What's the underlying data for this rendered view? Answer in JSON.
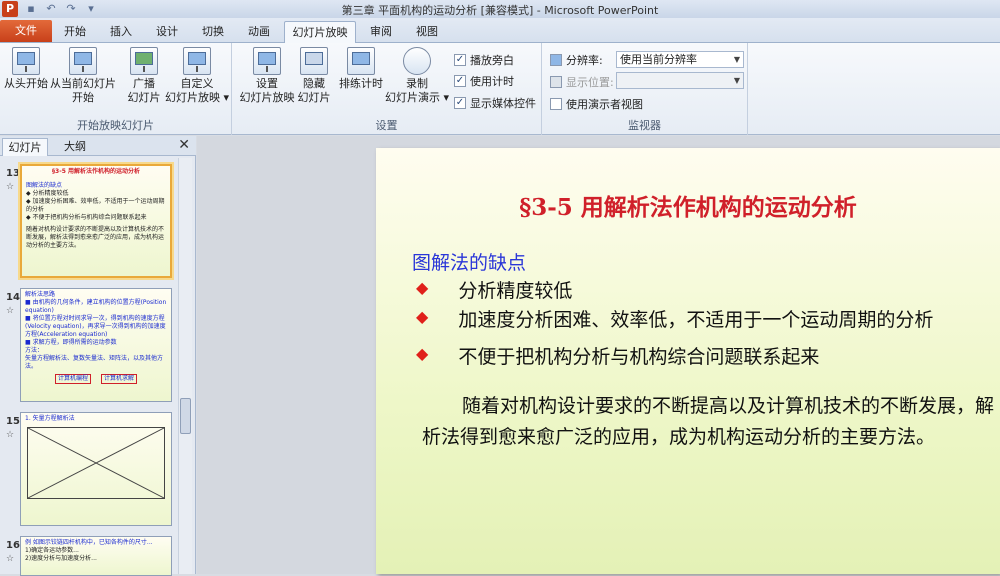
{
  "window": {
    "title": "第三章 平面机构的运动分析 [兼容模式] - Microsoft PowerPoint",
    "app_letter": "P"
  },
  "tabs": [
    "文件",
    "开始",
    "插入",
    "设计",
    "切换",
    "动画",
    "幻灯片放映",
    "审阅",
    "视图"
  ],
  "active_tab": "幻灯片放映",
  "ribbon": {
    "group_start": {
      "label": "开始放映幻灯片",
      "buttons": [
        {
          "line1": "从头开始",
          "line2": ""
        },
        {
          "line1": "从当前幻灯片",
          "line2": "开始"
        },
        {
          "line1": "广播",
          "line2": "幻灯片"
        },
        {
          "line1": "自定义",
          "line2": "幻灯片放映 ▾"
        }
      ]
    },
    "group_setup": {
      "label": "设置",
      "buttons": [
        {
          "line1": "设置",
          "line2": "幻灯片放映"
        },
        {
          "line1": "隐藏",
          "line2": "幻灯片"
        },
        {
          "line1": "排练计时",
          "line2": ""
        },
        {
          "line1": "录制",
          "line2": "幻灯片演示 ▾"
        }
      ],
      "checks": [
        {
          "label": "播放旁白",
          "checked": true
        },
        {
          "label": "使用计时",
          "checked": true
        },
        {
          "label": "显示媒体控件",
          "checked": true
        }
      ]
    },
    "group_monitor": {
      "label": "监视器",
      "resolution_label": "分辨率:",
      "resolution_value": "使用当前分辨率",
      "display_label": "显示位置:",
      "display_value": "",
      "presenter_view": "使用演示者视图"
    }
  },
  "panel": {
    "tab_slides": "幻灯片",
    "tab_outline": "大纲",
    "close": "✕",
    "slides": [
      {
        "num": "13",
        "star": "☆"
      },
      {
        "num": "14",
        "star": "☆"
      },
      {
        "num": "15",
        "star": "☆"
      },
      {
        "num": "16",
        "star": "☆"
      }
    ],
    "thumb13": {
      "title": "§3-5 用解析法作机构的运动分析",
      "lines": [
        "图解法的缺点",
        "◆ 分析精度较低",
        "◆ 加速度分析困难、效率低，不适用于一个运动周期的分析",
        "◆ 不便于把机构分析与机构综合问题联系起来",
        "随着对机构设计要求的不断提高以及计算机技术的不断发展，解析法得到愈来愈广泛的应用，成为机构运动分析的主要方法。"
      ]
    },
    "thumb14": {
      "lines": [
        "解析法思路",
        "■ 由机构的几何条件，建立机构的位置方程(Position equation)",
        "■ 将位置方程对时间求导一次，得到机构的速度方程(Velocity equation)，再求导一次得到机构的加速度方程(Acceleration equation)",
        "■ 求解方程，即得所需的运动参数",
        "方法：",
        "矢量方程解析法、复数矢量法、矩阵法，以及其他方法。"
      ],
      "boxes": [
        "计算机编程",
        "计算机求解"
      ]
    },
    "thumb15": {
      "lines": [
        "1. 矢量方程解析法"
      ]
    },
    "thumb16": {
      "lines": [
        "例 如图示铰链四杆机构中，已知各构件的尺寸...",
        "1)确定各运动参数...",
        "2)速度分析与加速度分析..."
      ]
    }
  },
  "slide": {
    "title": "§3-5  用解析法作机构的运动分析",
    "subtitle": "图解法的缺点",
    "bullets": [
      "分析精度较低",
      "加速度分析困难、效率低，不适用于一个运动周期的分析",
      "不便于把机构分析与机构综合问题联系起来"
    ],
    "bullet_glyph": "◆",
    "paragraph": "随着对机构设计要求的不断提高以及计算机技术的不断发展，解析法得到愈来愈广泛的应用，成为机构运动分析的主要方法。"
  },
  "colors": {
    "title_red": "#d0202a",
    "subtitle_blue": "#2a36d8",
    "accent_orange": "#c8401a"
  }
}
